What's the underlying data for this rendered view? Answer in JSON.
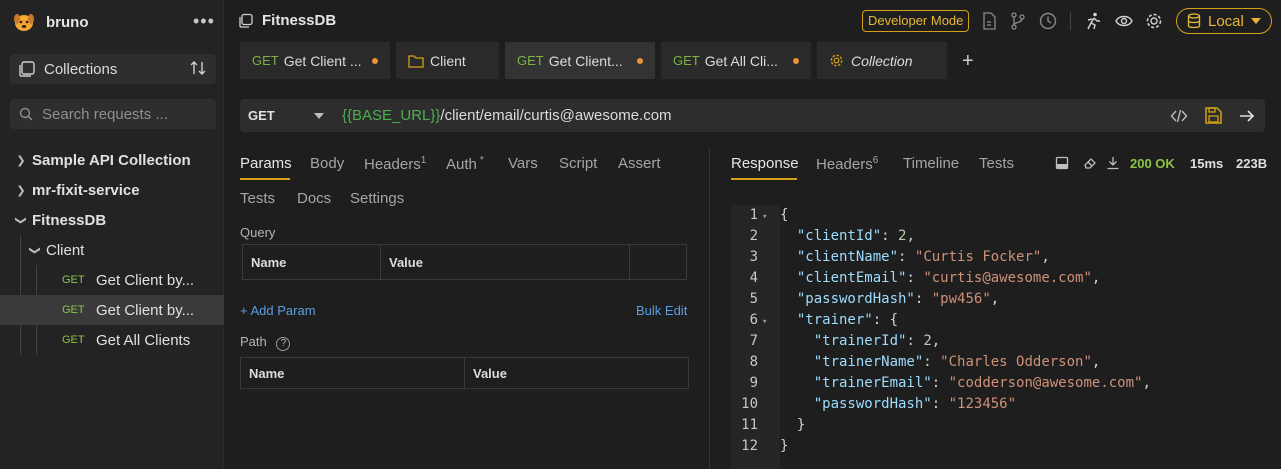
{
  "sidebar": {
    "brand": "bruno",
    "more": "•••",
    "collections_label": "Collections",
    "search_placeholder": "Search requests ...",
    "tree": [
      {
        "label": "Sample API Collection"
      },
      {
        "label": "mr-fixit-service"
      },
      {
        "label": "FitnessDB"
      },
      {
        "label": "Client"
      },
      {
        "method": "GET",
        "label": "Get Client by..."
      },
      {
        "method": "GET",
        "label": "Get Client by..."
      },
      {
        "method": "GET",
        "label": "Get All Clients"
      }
    ]
  },
  "topbar": {
    "collection_title": "FitnessDB",
    "developer_mode": "Developer Mode",
    "environment": "Local"
  },
  "tabs": [
    {
      "method": "GET",
      "label": "Get Client ...",
      "unsaved": true
    },
    {
      "method": "",
      "label": "Client",
      "unsaved": false
    },
    {
      "method": "GET",
      "label": "Get Client...",
      "unsaved": true,
      "active": true
    },
    {
      "method": "GET",
      "label": "Get All Cli...",
      "unsaved": true
    },
    {
      "method": "",
      "label": "Collection",
      "unsaved": false
    }
  ],
  "request": {
    "method": "GET",
    "url_var": "{{BASE_URL}}",
    "url_path": "/client/email/curtis@awesome.com",
    "tabs": [
      "Params",
      "Body",
      "Headers",
      "Auth",
      "Vars",
      "Script",
      "Assert",
      "Tests",
      "Docs",
      "Settings"
    ],
    "headers_count": "1",
    "auth_marker": "*",
    "query_label": "Query",
    "path_label": "Path",
    "help": "?",
    "col_name": "Name",
    "col_value": "Value",
    "add_param": "+ Add Param",
    "bulk_edit": "Bulk Edit"
  },
  "response": {
    "tabs": [
      "Response",
      "Headers",
      "Timeline",
      "Tests"
    ],
    "headers_count": "6",
    "status": "200 OK",
    "time": "15ms",
    "size": "223B",
    "lines": [
      "{",
      "  \"clientId\": 2,",
      "  \"clientName\": \"Curtis Focker\",",
      "  \"clientEmail\": \"curtis@awesome.com\",",
      "  \"passwordHash\": \"pw456\",",
      "  \"trainer\": {",
      "    \"trainerId\": 2,",
      "    \"trainerName\": \"Charles Odderson\",",
      "    \"trainerEmail\": \"codderson@awesome.com\",",
      "    \"passwordHash\": \"123456\"",
      "  }",
      "}"
    ]
  },
  "colors": {
    "accent": "#d4a017",
    "method_get": "#7cb342",
    "status_ok": "#8bc34a",
    "link": "#5c9ee0"
  }
}
